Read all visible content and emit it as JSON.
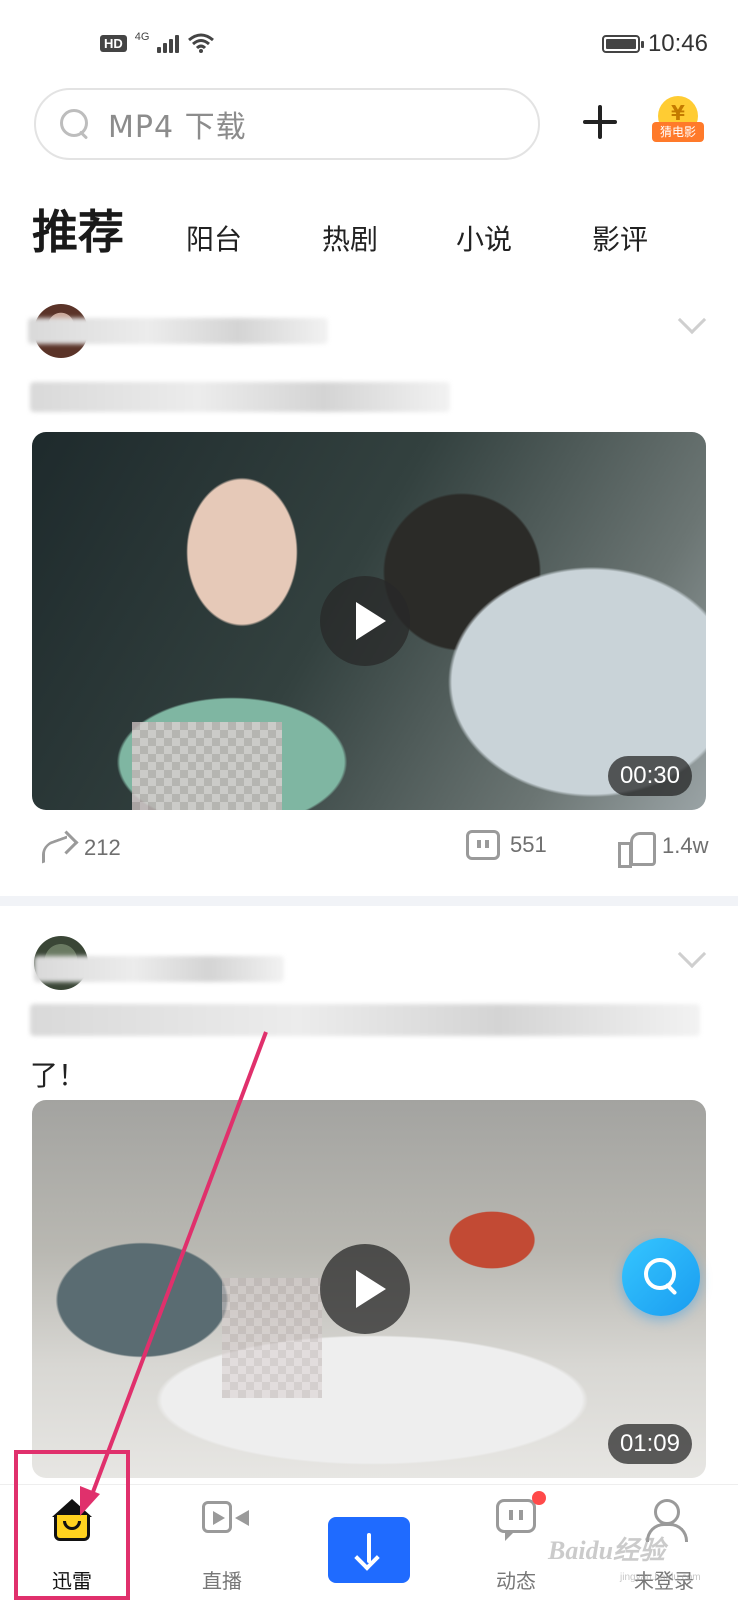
{
  "status_bar": {
    "hd": "HD",
    "network": "4G",
    "time": "10:46"
  },
  "search": {
    "placeholder": "MP4 下载"
  },
  "header_buttons": {
    "guess_coin": "¥",
    "guess_label": "猜电影"
  },
  "tabs": [
    {
      "label": "推荐",
      "active": true
    },
    {
      "label": "阳台"
    },
    {
      "label": "热剧"
    },
    {
      "label": "小说"
    },
    {
      "label": "影评"
    }
  ],
  "posts": [
    {
      "video_duration": "00:30",
      "share_count": "212",
      "comment_count": "551",
      "like_count": "1.4w"
    },
    {
      "title_visible": "了！",
      "video_duration": "01:09"
    }
  ],
  "bottom_nav": [
    {
      "label": "迅雷",
      "icon": "home-icon",
      "active": true
    },
    {
      "label": "直播",
      "icon": "video-icon"
    },
    {
      "label": "",
      "icon": "download-icon"
    },
    {
      "label": "动态",
      "icon": "message-icon",
      "badge": true
    },
    {
      "label": "未登录",
      "icon": "user-icon"
    }
  ],
  "watermark": {
    "text": "Baidu经验",
    "sub": "jingyan.baidu.com"
  },
  "colors": {
    "accent_yellow": "#ffd21f",
    "download_blue": "#1f6bff",
    "annotation_pink": "#e0306c"
  }
}
